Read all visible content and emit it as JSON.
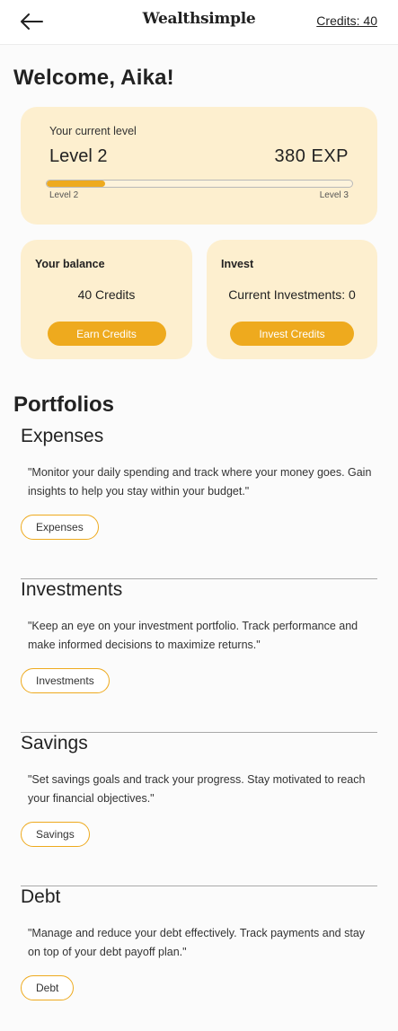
{
  "header": {
    "back_icon": "arrow-left-icon",
    "brand": "Wealthsimple",
    "credits_link": "Credits: 40"
  },
  "welcome": "Welcome, Aika!",
  "level": {
    "caption": "Your current level",
    "name": "Level 2",
    "exp": "380 EXP",
    "progress_fraction": 0.19,
    "from_label": "Level 2",
    "to_label": "Level 3"
  },
  "balance": {
    "title": "Your balance",
    "value": "40 Credits",
    "button": "Earn Credits"
  },
  "invest": {
    "title": "Invest",
    "value": "Current Investments: 0",
    "button": "Invest Credits"
  },
  "portfolios": {
    "title": "Portfolios",
    "items": [
      {
        "name": "Expenses",
        "description": "\"Monitor your daily spending and track where your money goes. Gain insights to help you stay within your budget.\"",
        "tag": "Expenses"
      },
      {
        "name": "Investments",
        "description": "\"Keep an eye on your investment portfolio. Track performance and make informed decisions to maximize returns.\"",
        "tag": "Investments"
      },
      {
        "name": "Savings",
        "description": "\"Set savings goals and track your progress. Stay motivated to reach your financial objectives.\"",
        "tag": "Savings"
      },
      {
        "name": "Debt",
        "description": "\"Manage and reduce your debt effectively. Track payments and stay on top of your debt payoff plan.\"",
        "tag": "Debt"
      }
    ]
  },
  "colors": {
    "accent": "#eeaa1e",
    "card": "#fdefcf",
    "background": "#fbfbfb"
  }
}
